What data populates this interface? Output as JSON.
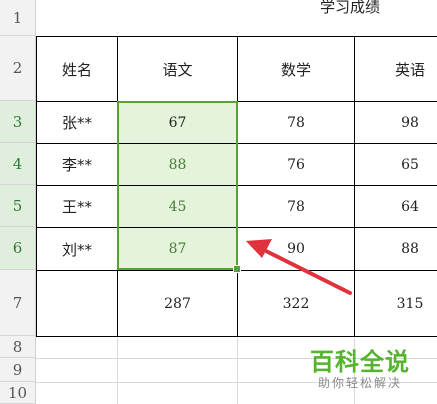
{
  "title": "学习成绩",
  "row_numbers": [
    "1",
    "2",
    "3",
    "4",
    "5",
    "6",
    "7",
    "8",
    "9",
    "10"
  ],
  "headers": {
    "name": "姓名",
    "chinese": "语文",
    "math": "数学",
    "english": "英语"
  },
  "rows": [
    {
      "name": "张**",
      "chinese": "67",
      "math": "78",
      "english": "98"
    },
    {
      "name": "李**",
      "chinese": "88",
      "math": "76",
      "english": "65"
    },
    {
      "name": "王**",
      "chinese": "45",
      "math": "78",
      "english": "64"
    },
    {
      "name": "刘**",
      "chinese": "87",
      "math": "90",
      "english": "88"
    }
  ],
  "totals": {
    "chinese": "287",
    "math": "322",
    "english": "315"
  },
  "watermark": {
    "logo": "百科全说",
    "slogan": "助你轻松解决"
  },
  "colors": {
    "selection_border": "#5aa03a",
    "selection_fill": "#e3f4da",
    "arrow": "#e0323c"
  }
}
